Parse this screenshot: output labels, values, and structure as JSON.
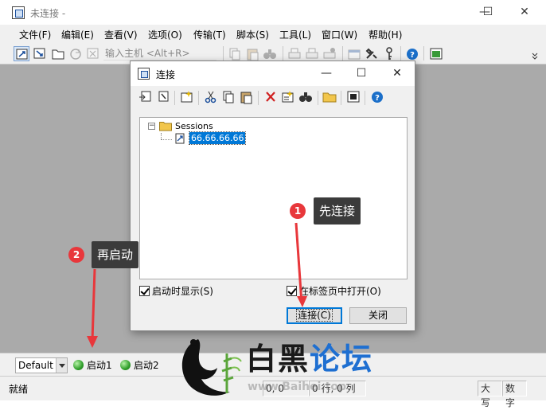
{
  "window": {
    "title": "未连接 -",
    "min": "—",
    "max": "☐",
    "close": "✕"
  },
  "menu": [
    "文件(F)",
    "编辑(E)",
    "查看(V)",
    "选项(O)",
    "传输(T)",
    "脚本(S)",
    "工具(L)",
    "窗口(W)",
    "帮助(H)"
  ],
  "toolbar": {
    "quick_connect_placeholder": "输入主机 <Alt+R>"
  },
  "dialog": {
    "title": "连接",
    "tree": {
      "root": "Sessions",
      "root_expander": "−",
      "session": "66.66.66.66"
    },
    "show_on_startup": "启动时显示(S)",
    "open_in_tab": "在标签页中打开(O)",
    "connect_button": "连接(C)",
    "close_button": "关闭"
  },
  "bottom_bar": {
    "session_select": "Default",
    "button1": "启动1",
    "button2": "启动2"
  },
  "status_bar": {
    "status": "就绪",
    "pos1": "0, 0",
    "pos2": "0 行, 0 列",
    "caps": "大写",
    "num": "数字"
  },
  "annotations": [
    {
      "number": "1",
      "text": "先连接"
    },
    {
      "number": "2",
      "text": "再启动"
    }
  ],
  "watermark": {
    "text_black": "白黑",
    "text_blue": "论坛",
    "url": "www.Baihei.top"
  },
  "colors": {
    "workspace": "#aaaaaa",
    "badge": "#e8373b",
    "callout": "#3b3b3b",
    "arrow": "#e8373b",
    "selection": "#0078d7"
  }
}
